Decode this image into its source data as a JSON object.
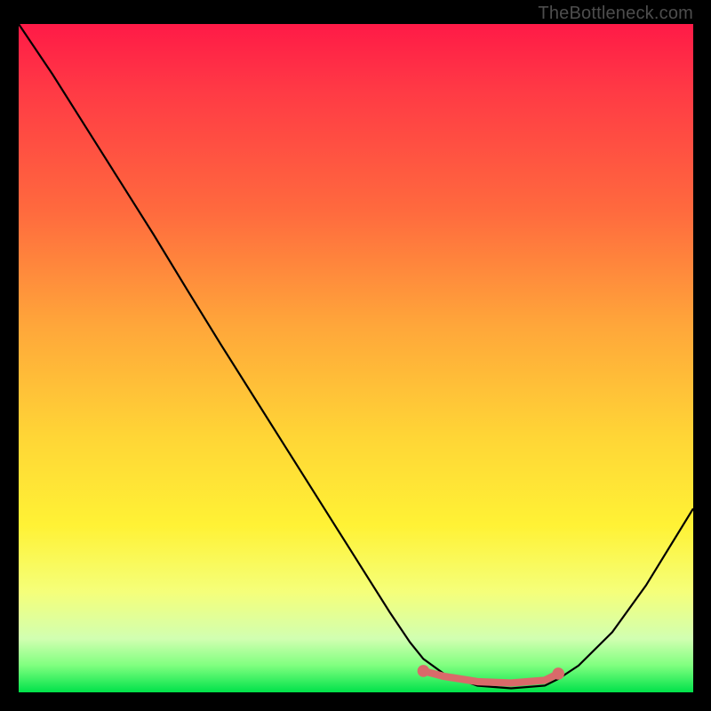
{
  "attribution": "TheBottleneck.com",
  "colors": {
    "background": "#000000",
    "gradient_top": "#ff1a47",
    "gradient_mid1": "#ff6a3e",
    "gradient_mid2": "#ffd636",
    "gradient_mid3": "#fff235",
    "gradient_bottom": "#00e24a",
    "curve": "#000000",
    "highlight": "#d96a6a"
  },
  "chart_data": {
    "type": "line",
    "title": "",
    "xlabel": "",
    "ylabel": "",
    "xlim": [
      0,
      100
    ],
    "ylim": [
      0,
      100
    ],
    "grid": false,
    "series": [
      {
        "name": "bottleneck-curve",
        "x": [
          0,
          5,
          10,
          15,
          20,
          25,
          30,
          35,
          40,
          45,
          50,
          55,
          58,
          60,
          63,
          68,
          73,
          78,
          80,
          83,
          88,
          93,
          100
        ],
        "y": [
          100,
          92.5,
          84.5,
          76.5,
          68.5,
          60.2,
          52.0,
          44.0,
          36.0,
          28.0,
          20.0,
          12.0,
          7.5,
          5.0,
          2.8,
          1.0,
          0.6,
          1.0,
          2.0,
          4.0,
          9.0,
          16.0,
          27.5
        ]
      }
    ],
    "highlight_segment": {
      "name": "optimal-range",
      "x": [
        60,
        63,
        68,
        73,
        78,
        80
      ],
      "y": [
        3.2,
        2.4,
        1.6,
        1.4,
        1.8,
        2.8
      ],
      "endpoint_radius_pct": 0.9,
      "stroke_width_pct": 1.1
    }
  }
}
